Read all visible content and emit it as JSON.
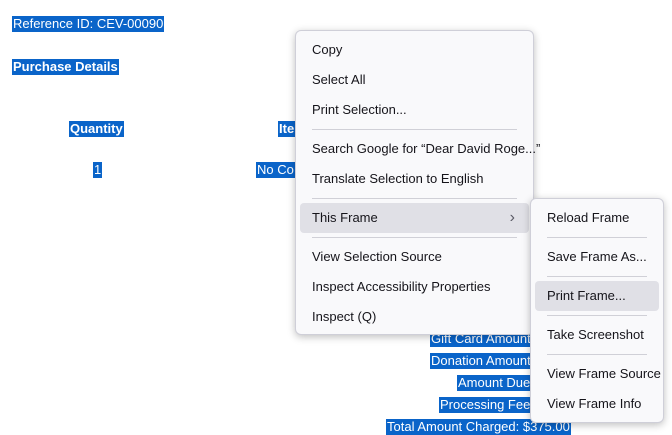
{
  "background": {
    "reference_id": "Reference ID: CEV-00090",
    "purchase_details": "Purchase Details",
    "col_quantity": "Quantity",
    "col_item": "Ite",
    "qty_value": "1",
    "item_value": "No Co",
    "gift_card": "Gift Card Amount",
    "donation": "Donation Amount",
    "amount_due": "Amount Due",
    "processing_fee": "Processing Fee",
    "total_charged": "Total Amount Charged: $375.00"
  },
  "context_menu": {
    "copy": "Copy",
    "select_all": "Select All",
    "print_selection": "Print Selection...",
    "search_google": "Search Google for “Dear David Roge...”",
    "translate": "Translate Selection to English",
    "this_frame": "This Frame",
    "view_selection_source": "View Selection Source",
    "inspect_accessibility": "Inspect Accessibility Properties",
    "inspect": "Inspect (Q)"
  },
  "submenu": {
    "reload_frame": "Reload Frame",
    "save_frame_as": "Save Frame As...",
    "print_frame": "Print Frame...",
    "take_screenshot": "Take Screenshot",
    "view_frame_source": "View Frame Source",
    "view_frame_info": "View Frame Info"
  },
  "colors": {
    "selection": "#0a64c9",
    "menu_background": "#f9f9fb",
    "menu_highlight": "#e0e0e6"
  }
}
